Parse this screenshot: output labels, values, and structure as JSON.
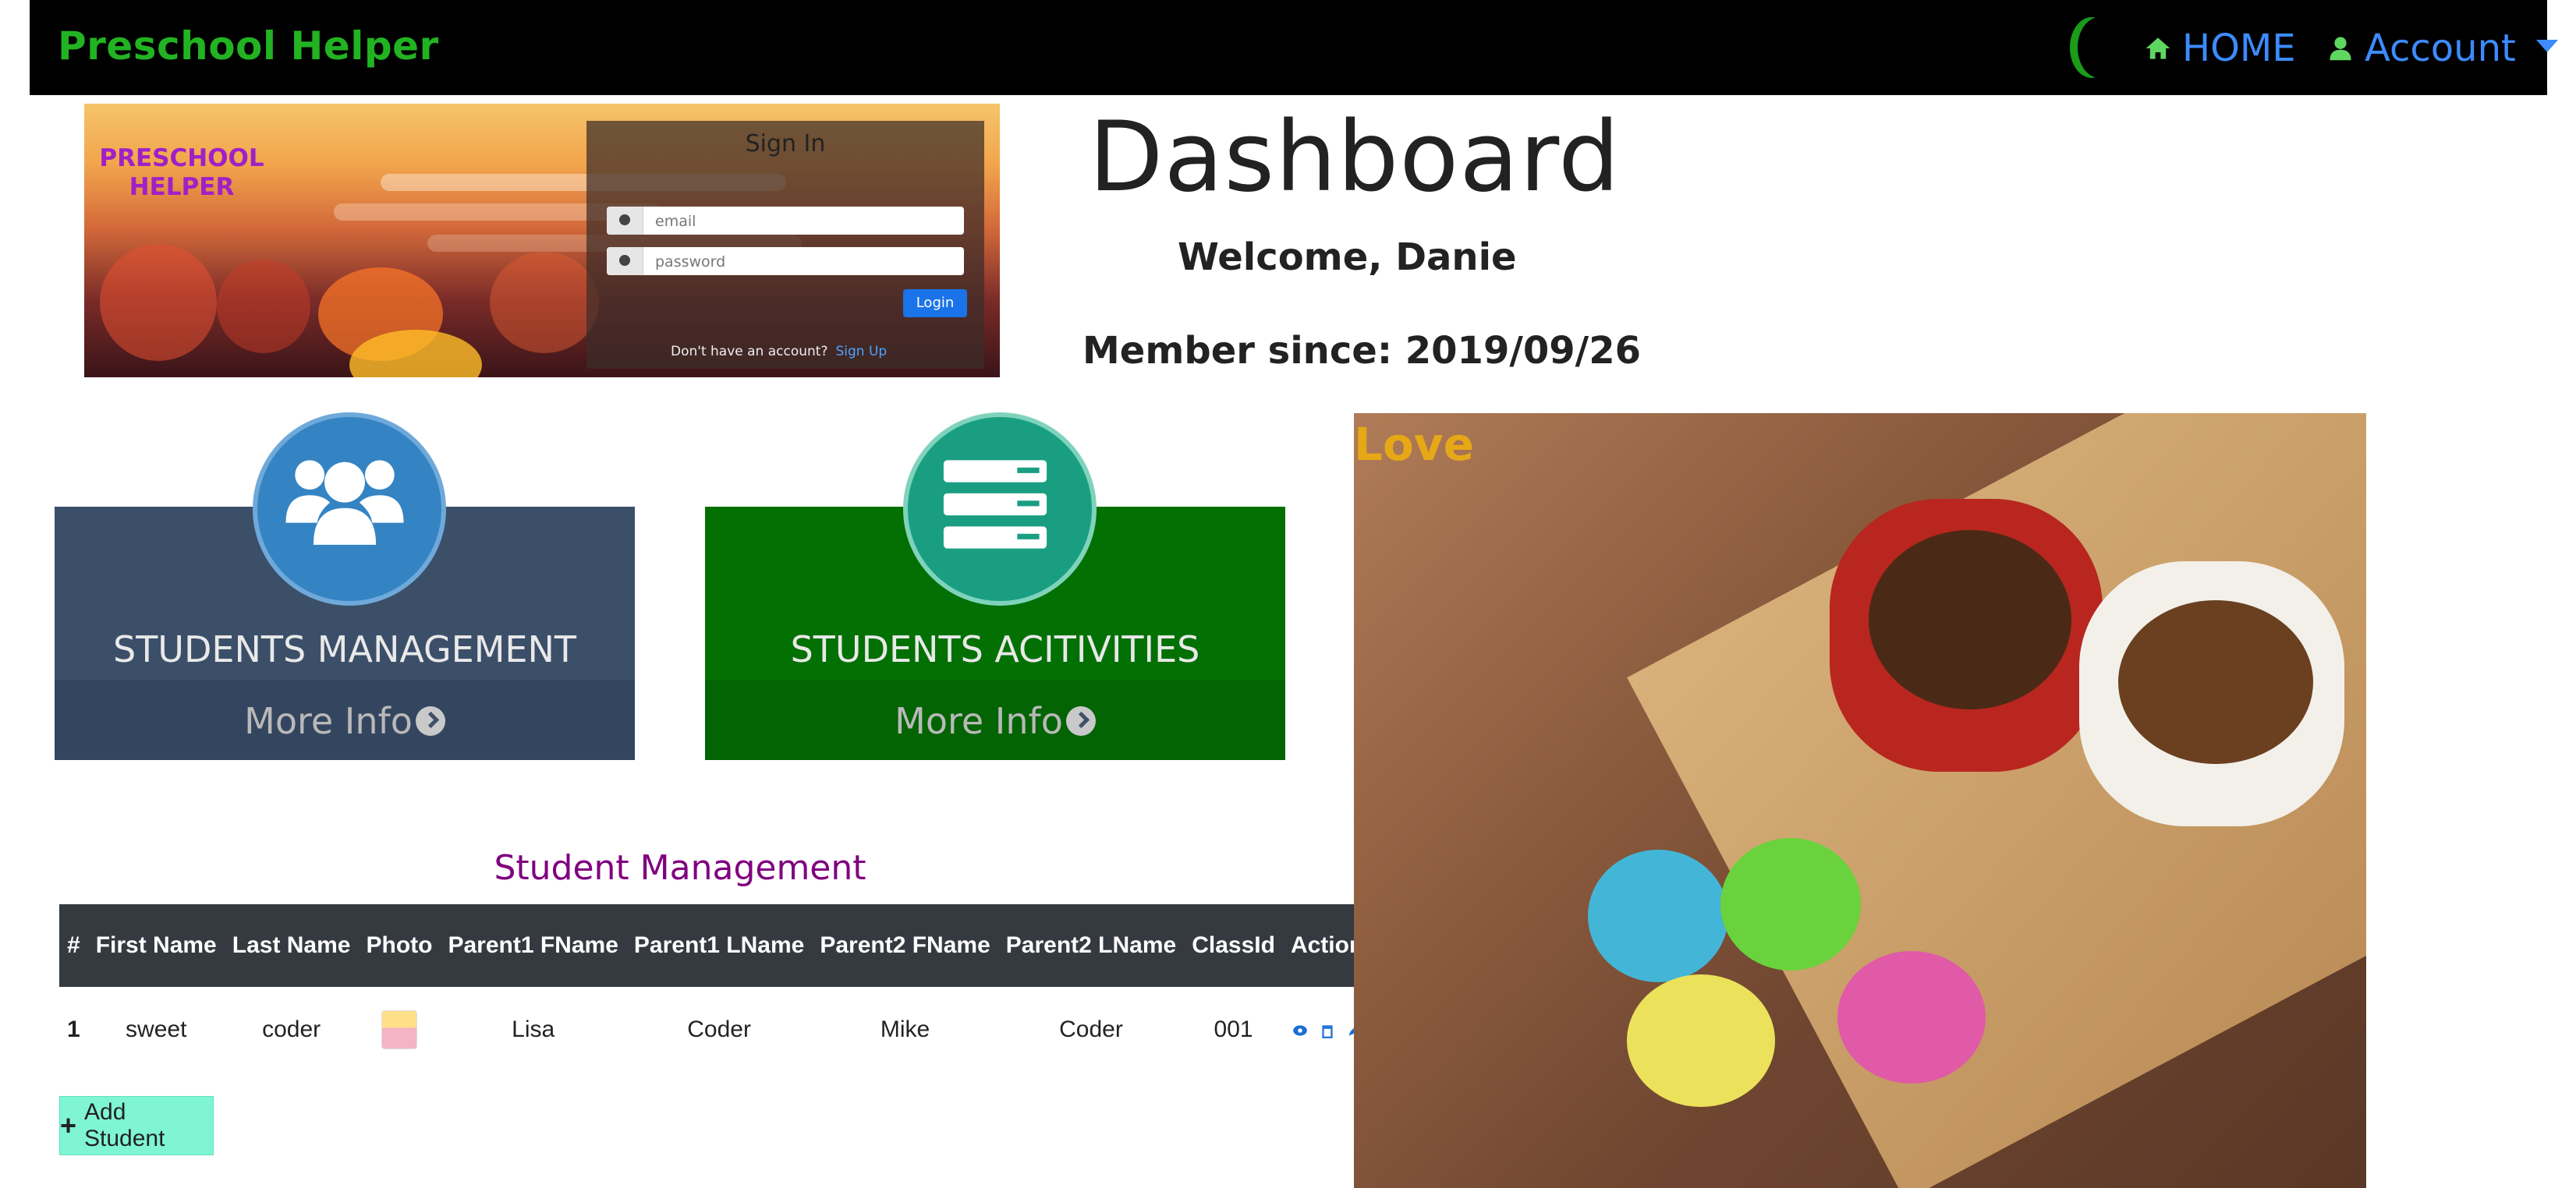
{
  "navbar": {
    "brand": "Preschool Helper",
    "home_label": "HOME",
    "account_label": "Account",
    "colors": {
      "background": "#000000",
      "brand": "#22b322",
      "links": "#3d8bff"
    }
  },
  "banner": {
    "title": "PRESCHOOL HELPER",
    "signin_title": "Sign In",
    "email_placeholder": "email",
    "password_placeholder": "password",
    "login_label": "Login",
    "no_account_text": "Don't have an account?",
    "signup_label": "Sign Up"
  },
  "dashboard": {
    "title": "Dashboard",
    "welcome": "Welcome, Danie",
    "member_since": "Member since: 2019/09/26"
  },
  "cards": [
    {
      "label": "STUDENTS MANAGEMENT",
      "more": "More Info",
      "icon": "users-icon",
      "color": "#3c4f69"
    },
    {
      "label": "STUDENTS ACITIVITIES",
      "more": "More Info",
      "icon": "list-icon",
      "color": "#037003"
    }
  ],
  "student_table": {
    "title": "Student Management",
    "headers": [
      "#",
      "First Name",
      "Last Name",
      "Photo",
      "Parent1 FName",
      "Parent1 LName",
      "Parent2 FName",
      "Parent2 LName",
      "ClassId",
      "Action"
    ],
    "rows": [
      {
        "num": "1",
        "first": "sweet",
        "last": "coder",
        "photo": "student-photo-icon",
        "p1f": "Lisa",
        "p1l": "Coder",
        "p2f": "Mike",
        "p2l": "Coder",
        "classid": "001",
        "actions": [
          "view-icon",
          "trash-icon",
          "edit-icon"
        ]
      }
    ],
    "add_label": "Add Student"
  },
  "photo": {
    "label": "Love"
  }
}
